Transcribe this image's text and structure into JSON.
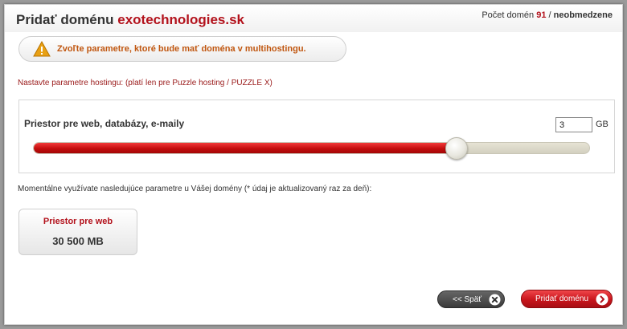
{
  "header": {
    "title_prefix": "Pridať doménu",
    "domain": "exotechnologies.sk",
    "counter_label": "Počet domén",
    "counter_value": "91",
    "counter_separator": "/",
    "counter_limit": "neobmedzene"
  },
  "warning": {
    "icon": "warning-triangle-icon",
    "text": "Zvoľte parametre, ktoré bude mať doména v multihostingu."
  },
  "hosting_note": "Nastavte parametre hostingu: (platí len pre Puzzle hosting / PUZZLE X)",
  "parameter": {
    "label": "Priestor pre web, databázy, e-maily",
    "value": "3",
    "unit": "GB",
    "slider_fraction": 0.76
  },
  "usage_note": "Momentálne využívate nasledujúce parametre u Vášej domény (* údaj je aktualizovaný raz za deň):",
  "usage_card": {
    "title": "Priestor pre web",
    "value": "30 500 MB"
  },
  "buttons": {
    "back_label": "<< Späť",
    "back_icon": "close-x-icon",
    "add_label": "Pridať doménu",
    "add_icon": "arrow-right-icon"
  },
  "colors": {
    "accent": "#b3121c",
    "warning_text": "#c0560f",
    "slider_fill": "#c40d0d"
  }
}
